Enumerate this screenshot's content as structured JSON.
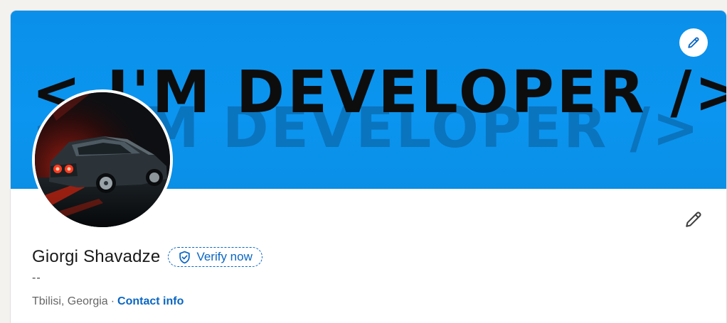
{
  "banner": {
    "text": "< I'M DEVELOPER />",
    "background_color": "#0b95f0",
    "text_color": "#0d0d0d",
    "edit_icon": "pencil-icon"
  },
  "avatar": {
    "description_icon": "car-photo"
  },
  "profile": {
    "name": "Giorgi Shavadze",
    "verify_label": "Verify now",
    "verify_icon": "shield-check-icon",
    "headline": "--",
    "location": "Tbilisi, Georgia",
    "separator": "·",
    "contact_label": "Contact info",
    "edit_icon": "pencil-icon"
  },
  "colors": {
    "accent": "#0a66c2",
    "page_bg": "#f4f2ee"
  }
}
